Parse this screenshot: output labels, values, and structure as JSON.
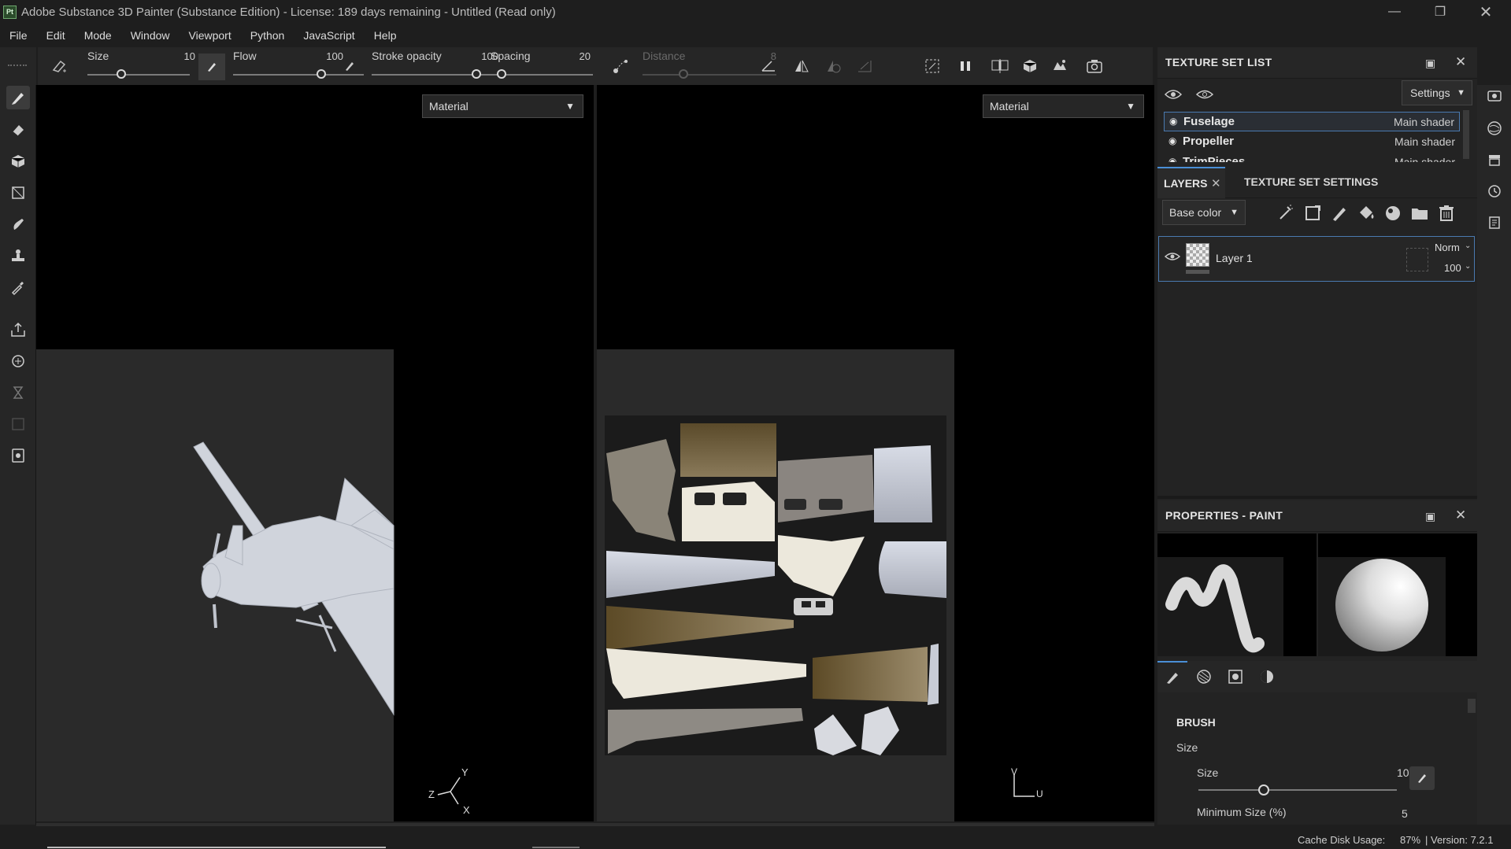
{
  "app": {
    "logo_text": "Pt",
    "title": "Adobe Substance 3D Painter (Substance Edition) - License: 189 days remaining - Untitled (Read only)"
  },
  "menu": [
    "File",
    "Edit",
    "Mode",
    "Window",
    "Viewport",
    "Python",
    "JavaScript",
    "Help"
  ],
  "toolbar": {
    "size_label": "Size",
    "size_value": "10",
    "flow_label": "Flow",
    "flow_value": "100",
    "stroke_opacity_label": "Stroke opacity",
    "stroke_opacity_value": "100",
    "spacing_label": "Spacing",
    "spacing_value": "20",
    "distance_label": "Distance",
    "distance_value": "8"
  },
  "viewport3d": {
    "material_select": "Material",
    "axis_y": "Y",
    "axis_z": "Z",
    "axis_x": "X"
  },
  "viewport2d": {
    "material_select": "Material",
    "axis_v": "V",
    "axis_u": "U"
  },
  "texture_set_list": {
    "title": "TEXTURE SET LIST",
    "settings_label": "Settings",
    "items": [
      {
        "name": "Fuselage",
        "shader": "Main shader"
      },
      {
        "name": "Propeller",
        "shader": "Main shader"
      },
      {
        "name": "TrimPieces",
        "shader": "Main shader"
      }
    ]
  },
  "layers": {
    "tab_layers": "LAYERS",
    "tab_texture_set_settings": "TEXTURE SET SETTINGS",
    "channel_select": "Base color",
    "items": [
      {
        "name": "Layer 1",
        "blend": "Norm",
        "opacity": "100"
      }
    ]
  },
  "properties": {
    "title": "PROPERTIES - PAINT",
    "section": "BRUSH",
    "subsection": "Size",
    "size_label": "Size",
    "size_value": "10",
    "min_size_label": "Minimum Size (%)",
    "min_size_value": "5"
  },
  "status": {
    "cache_label": "Cache Disk Usage:",
    "cache_value": "87%",
    "version": "| Version: 7.2.1"
  }
}
